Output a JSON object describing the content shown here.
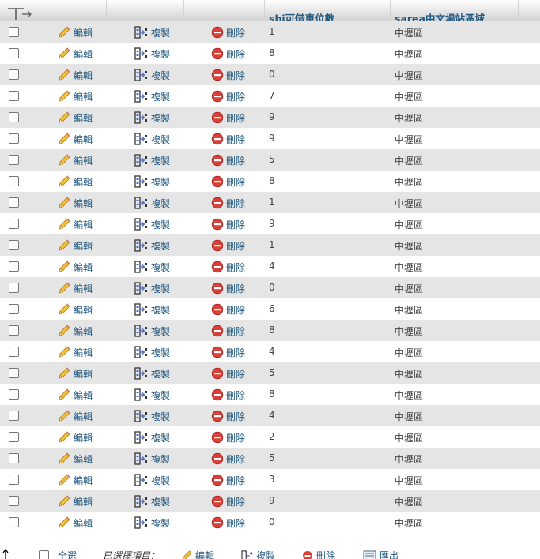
{
  "header": {
    "columns": [
      {
        "label": "sbi可借車位數"
      },
      {
        "label": "sarea中文場站區域"
      }
    ]
  },
  "actions": {
    "edit_label": "編輯",
    "copy_label": "複製",
    "delete_label": "刪除"
  },
  "rows": [
    {
      "sbi": "1",
      "sarea": "中壢區"
    },
    {
      "sbi": "8",
      "sarea": "中壢區"
    },
    {
      "sbi": "0",
      "sarea": "中壢區"
    },
    {
      "sbi": "7",
      "sarea": "中壢區"
    },
    {
      "sbi": "9",
      "sarea": "中壢區"
    },
    {
      "sbi": "9",
      "sarea": "中壢區"
    },
    {
      "sbi": "5",
      "sarea": "中壢區"
    },
    {
      "sbi": "8",
      "sarea": "中壢區"
    },
    {
      "sbi": "1",
      "sarea": "中壢區"
    },
    {
      "sbi": "9",
      "sarea": "中壢區"
    },
    {
      "sbi": "1",
      "sarea": "中壢區"
    },
    {
      "sbi": "4",
      "sarea": "中壢區"
    },
    {
      "sbi": "0",
      "sarea": "中壢區"
    },
    {
      "sbi": "6",
      "sarea": "中壢區"
    },
    {
      "sbi": "8",
      "sarea": "中壢區"
    },
    {
      "sbi": "4",
      "sarea": "中壢區"
    },
    {
      "sbi": "5",
      "sarea": "中壢區"
    },
    {
      "sbi": "8",
      "sarea": "中壢區"
    },
    {
      "sbi": "4",
      "sarea": "中壢區"
    },
    {
      "sbi": "2",
      "sarea": "中壢區"
    },
    {
      "sbi": "5",
      "sarea": "中壢區"
    },
    {
      "sbi": "3",
      "sarea": "中壢區"
    },
    {
      "sbi": "9",
      "sarea": "中壢區"
    },
    {
      "sbi": "0",
      "sarea": "中壢區"
    }
  ],
  "footer": {
    "select_all": "全選",
    "with_selected": "已選擇項目：",
    "edit": "編輯",
    "copy": "複製",
    "delete": "刪除",
    "export": "匯出"
  },
  "colors": {
    "link": "#235a81",
    "row_odd": "#e5e5e5",
    "row_even": "#ffffff",
    "delete_icon": "#d9403a",
    "pencil_icon": "#e8a52a"
  }
}
